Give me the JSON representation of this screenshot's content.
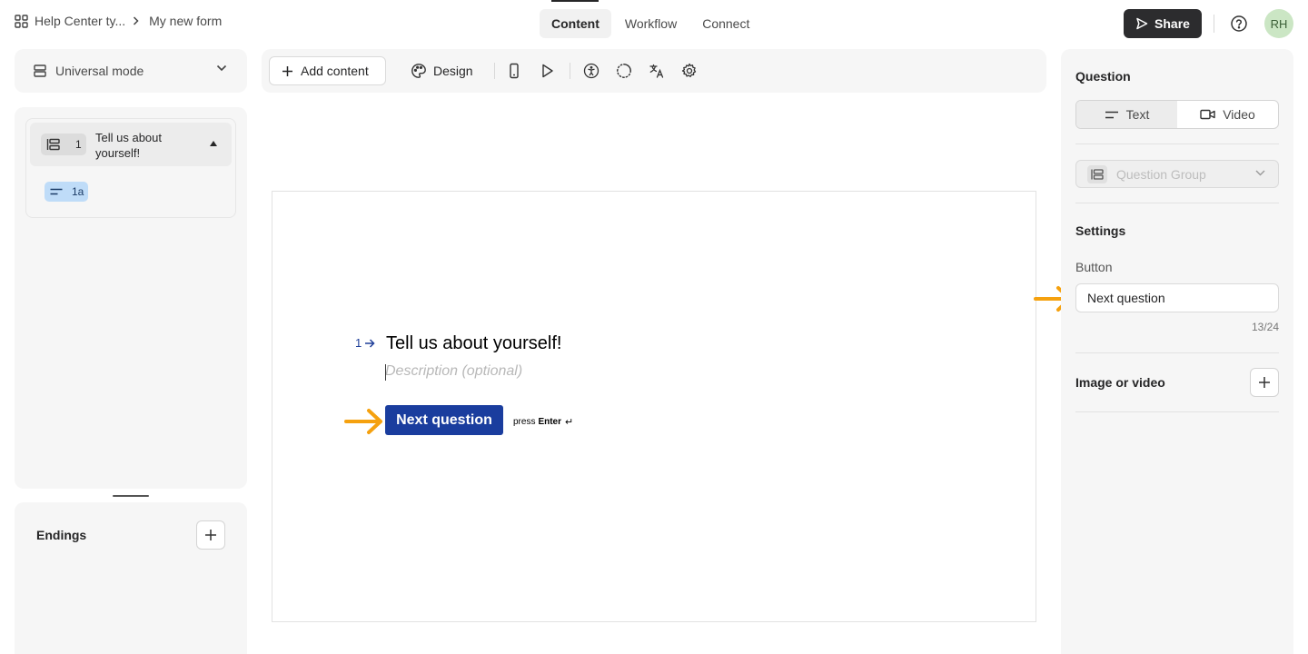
{
  "breadcrumb": {
    "workspace": "Help Center ty...",
    "form": "My new form"
  },
  "tabs": [
    "Content",
    "Workflow",
    "Connect"
  ],
  "header": {
    "share_label": "Share",
    "avatar_initials": "RH"
  },
  "left_panel": {
    "mode_label": "Universal mode",
    "question": {
      "number": "1",
      "title": "Tell us about yourself!",
      "sub_item": "1a"
    },
    "endings_label": "Endings"
  },
  "toolbar": {
    "add_content_label": "Add content",
    "design_label": "Design"
  },
  "canvas": {
    "question_number": "1",
    "question_title": "Tell us about yourself!",
    "description_placeholder": "Description (optional)",
    "button_label": "Next question",
    "press_label": "press",
    "enter_label": "Enter",
    "return_glyph": "↵"
  },
  "right_panel": {
    "question_heading": "Question",
    "type_text": "Text",
    "type_video": "Video",
    "group_placeholder": "Question Group",
    "settings_heading": "Settings",
    "button_field_label": "Button",
    "button_field_value": "Next question",
    "char_count": "13/24",
    "image_or_video_label": "Image or video"
  },
  "colors": {
    "accent_button": "#1a3d9e",
    "share_button": "#2c2c2e",
    "annotation_arrow": "#f5a10f",
    "avatar_bg": "#cbe6c4",
    "sub_badge_bg": "#bfdcf8"
  }
}
